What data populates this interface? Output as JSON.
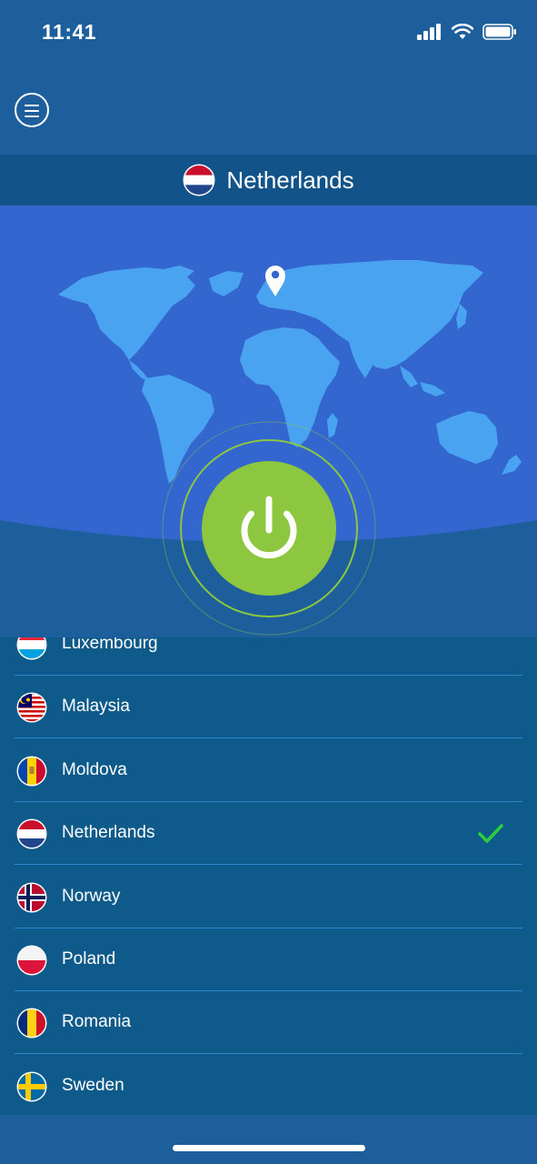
{
  "status_bar": {
    "time": "11:41"
  },
  "header": {
    "menu_icon": "hamburger-menu-icon"
  },
  "selected_country": {
    "name": "Netherlands",
    "flag": "netherlands-flag-icon"
  },
  "map": {
    "pin_icon": "location-pin-icon"
  },
  "power_button": {
    "icon": "power-icon",
    "state_color": "#8dc63f"
  },
  "countries": [
    {
      "name": "Luxembourg",
      "flag": "luxembourg-flag-icon",
      "selected": false
    },
    {
      "name": "Malaysia",
      "flag": "malaysia-flag-icon",
      "selected": false
    },
    {
      "name": "Moldova",
      "flag": "moldova-flag-icon",
      "selected": false
    },
    {
      "name": "Netherlands",
      "flag": "netherlands-flag-icon",
      "selected": true
    },
    {
      "name": "Norway",
      "flag": "norway-flag-icon",
      "selected": false
    },
    {
      "name": "Poland",
      "flag": "poland-flag-icon",
      "selected": false
    },
    {
      "name": "Romania",
      "flag": "romania-flag-icon",
      "selected": false
    },
    {
      "name": "Sweden",
      "flag": "sweden-flag-icon",
      "selected": false
    }
  ],
  "colors": {
    "background": "#1d5f9d",
    "map_ocean": "#3466d0",
    "land": "#4aa3f0",
    "list_background": "#0e5a8a",
    "connected_green": "#8dc63f",
    "check_green": "#2ecc40"
  }
}
